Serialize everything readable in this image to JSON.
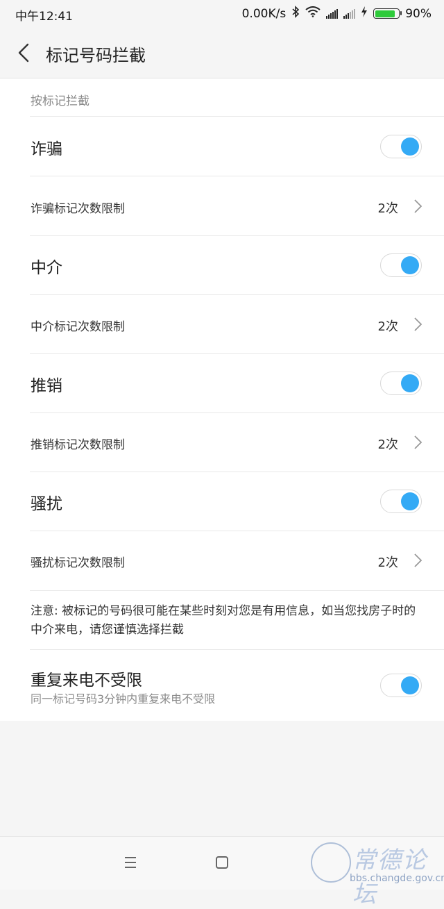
{
  "status_bar": {
    "time": "中午12:41",
    "speed": "0.00K/s",
    "battery": "90%"
  },
  "header": {
    "title": "标记号码拦截"
  },
  "section": {
    "header": "按标记拦截"
  },
  "categories": [
    {
      "label": "诈骗",
      "toggle_on": true,
      "limit_label": "诈骗标记次数限制",
      "limit_value": "2次"
    },
    {
      "label": "中介",
      "toggle_on": true,
      "limit_label": "中介标记次数限制",
      "limit_value": "2次"
    },
    {
      "label": "推销",
      "toggle_on": true,
      "limit_label": "推销标记次数限制",
      "limit_value": "2次"
    },
    {
      "label": "骚扰",
      "toggle_on": true,
      "limit_label": "骚扰标记次数限制",
      "limit_value": "2次"
    }
  ],
  "note": "注意: 被标记的号码很可能在某些时刻对您是有用信息，如当您找房子时的中介来电，请您谨慎选择拦截",
  "repeat": {
    "title": "重复来电不受限",
    "subtitle": "同一标记号码3分钟内重复来电不受限",
    "toggle_on": true
  },
  "watermark": {
    "text": "常德论坛",
    "url": "bbs.changde.gov.cn"
  },
  "colors": {
    "accent": "#34aaf5",
    "background": "#f5f5f5"
  }
}
